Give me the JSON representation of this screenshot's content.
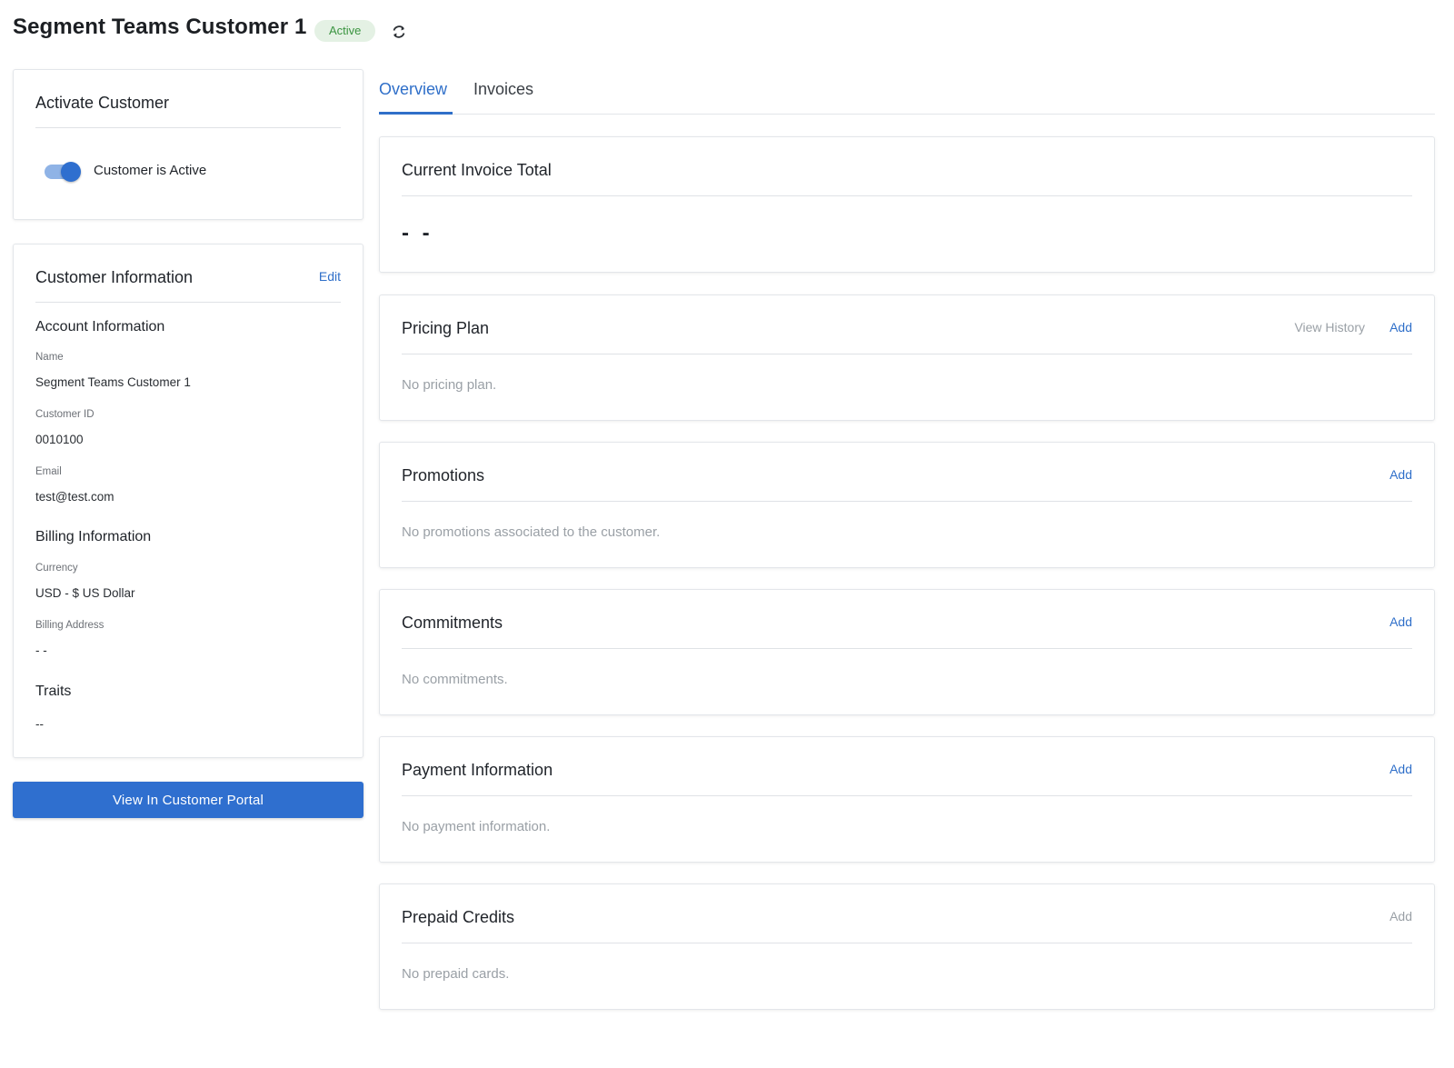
{
  "header": {
    "title": "Segment Teams Customer 1",
    "status_badge": "Active"
  },
  "activate_card": {
    "title": "Activate Customer",
    "toggle_label": "Customer is Active",
    "toggle_on": true
  },
  "customer_info": {
    "title": "Customer Information",
    "edit_label": "Edit",
    "account_heading": "Account Information",
    "name_label": "Name",
    "name_value": "Segment Teams Customer 1",
    "customer_id_label": "Customer ID",
    "customer_id_value": "0010100",
    "email_label": "Email",
    "email_value": "test@test.com",
    "billing_heading": "Billing Information",
    "currency_label": "Currency",
    "currency_value": "USD - $ US Dollar",
    "billing_address_label": "Billing Address",
    "billing_address_value": "- -",
    "traits_heading": "Traits",
    "traits_value": "--"
  },
  "portal_button_label": "View In Customer Portal",
  "tabs": [
    {
      "label": "Overview",
      "active": true
    },
    {
      "label": "Invoices",
      "active": false
    }
  ],
  "panels": {
    "invoice_total": {
      "title": "Current Invoice Total",
      "value": "- -"
    },
    "pricing_plan": {
      "title": "Pricing Plan",
      "view_history": "View History",
      "add": "Add",
      "empty": "No pricing plan."
    },
    "promotions": {
      "title": "Promotions",
      "add": "Add",
      "empty": "No promotions associated to the customer."
    },
    "commitments": {
      "title": "Commitments",
      "add": "Add",
      "empty": "No commitments."
    },
    "payment_information": {
      "title": "Payment Information",
      "add": "Add",
      "empty": "No payment information."
    },
    "prepaid_credits": {
      "title": "Prepaid Credits",
      "add": "Add",
      "empty": "No prepaid cards."
    }
  },
  "colors": {
    "accent": "#2f6fc9",
    "badge_bg": "#e4f1e4",
    "badge_text": "#3a9440",
    "muted_text": "#9aa0a6"
  },
  "icons": {
    "refresh": "refresh-icon"
  }
}
